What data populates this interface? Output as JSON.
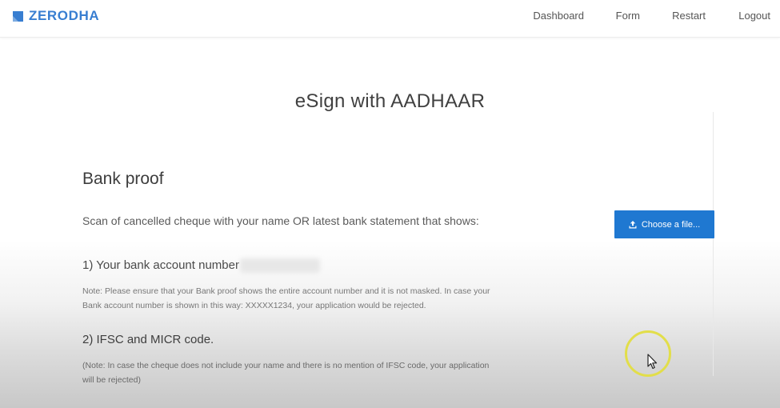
{
  "brand": {
    "name": "ZERODHA",
    "accent": "#387ed1"
  },
  "nav": {
    "items": [
      {
        "label": "Dashboard"
      },
      {
        "label": "Form"
      },
      {
        "label": "Restart"
      },
      {
        "label": "Logout"
      }
    ]
  },
  "page": {
    "title": "eSign with AADHAAR"
  },
  "bank_proof": {
    "title": "Bank proof",
    "intro": "Scan of cancelled cheque with your name OR latest bank statement that shows:",
    "item1": "1) Your bank account number",
    "note1": "Note: Please ensure that your Bank proof shows the entire account number and it is not masked. In case your Bank account number is shown in this way: XXXXX1234, your application would be rejected.",
    "item2": "2) IFSC and MICR code.",
    "note2": "(Note: In case the cheque does not include your name and there is no mention of IFSC code, your application will be rejected)",
    "upload": {
      "label": "Choose a file...",
      "icon": "upload-icon",
      "color": "#1f78d1"
    }
  },
  "cursor": {
    "icon": "mouse-pointer-icon",
    "highlight_color": "#e2de4a"
  }
}
